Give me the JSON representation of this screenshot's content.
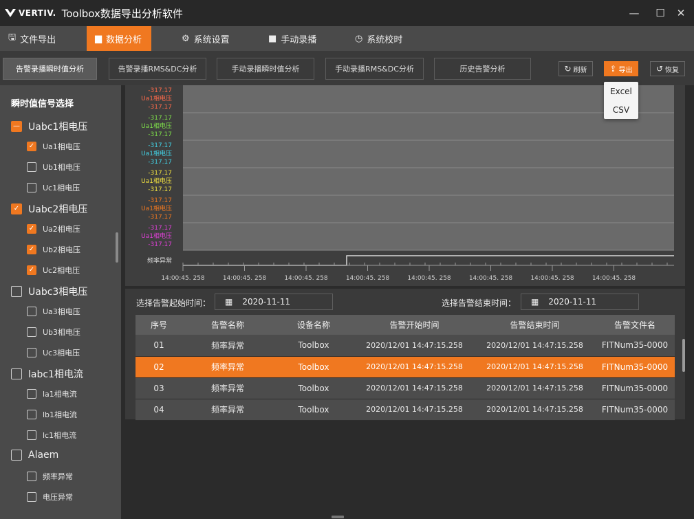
{
  "window": {
    "brand": "VERTIV.",
    "title": "Toolbox数据导出分析软件",
    "minimize": "—",
    "maximize": "☐",
    "close": "✕"
  },
  "menu": {
    "items": [
      {
        "label": "文件导出",
        "icon": "save-icon",
        "glyph": "🖫"
      },
      {
        "label": "数据分析",
        "icon": "bar-chart-icon",
        "glyph": "▆"
      },
      {
        "label": "系统设置",
        "icon": "gear-icon",
        "glyph": "⚙"
      },
      {
        "label": "手动录播",
        "icon": "video-camera-icon",
        "glyph": "■"
      },
      {
        "label": "系统校时",
        "icon": "clock-icon",
        "glyph": "◷"
      }
    ],
    "active": 1
  },
  "tabs": {
    "items": [
      "告警录播瞬时值分析",
      "告警录播RMS&DC分析",
      "手动录播瞬时值分析",
      "手动录播RMS&DC分析",
      "历史告警分析"
    ],
    "active": 0
  },
  "toolbar": {
    "refresh_label": "刷新",
    "export_label": "导出",
    "restore_label": "恢复",
    "refresh_icon": "↻",
    "export_icon": "⇪",
    "restore_icon": "↺"
  },
  "export_menu": {
    "options": [
      "Excel",
      "CSV"
    ]
  },
  "sidebar": {
    "title": "瞬时值信号选择",
    "groups": [
      {
        "label": "Uabc1相电压",
        "state": "partial",
        "items": [
          {
            "label": "Ua1相电压",
            "checked": true
          },
          {
            "label": "Ub1相电压",
            "checked": false
          },
          {
            "label": "Uc1相电压",
            "checked": false
          }
        ]
      },
      {
        "label": "Uabc2相电压",
        "state": "checked",
        "items": [
          {
            "label": "Ua2相电压",
            "checked": true
          },
          {
            "label": "Ub2相电压",
            "checked": true
          },
          {
            "label": "Uc2相电压",
            "checked": true
          }
        ]
      },
      {
        "label": "Uabc3相电压",
        "state": "unchecked",
        "items": [
          {
            "label": "Ua3相电压",
            "checked": false
          },
          {
            "label": "Ub3相电压",
            "checked": false
          },
          {
            "label": "Uc3相电压",
            "checked": false
          }
        ]
      },
      {
        "label": "labc1相电流",
        "state": "unchecked",
        "items": [
          {
            "label": "la1相电流",
            "checked": false
          },
          {
            "label": "lb1相电流",
            "checked": false
          },
          {
            "label": "lc1相电流",
            "checked": false
          }
        ]
      },
      {
        "label": "Alaem",
        "state": "unchecked",
        "items": [
          {
            "label": "频率异常",
            "checked": false
          },
          {
            "label": "电压异常",
            "checked": false
          }
        ]
      }
    ]
  },
  "chart": {
    "channels": [
      {
        "top": "-317.17",
        "name": "Ua1相电压",
        "bottom": "-317.17",
        "color": "#ff6a4a"
      },
      {
        "top": "-317.17",
        "name": "Ua1相电压",
        "bottom": "-317.17",
        "color": "#7fe04a"
      },
      {
        "top": "-317.17",
        "name": "Ua1相电压",
        "bottom": "-317.17",
        "color": "#43d3e6"
      },
      {
        "top": "-317.17",
        "name": "Ua1相电压",
        "bottom": "-317.17",
        "color": "#f0e040"
      },
      {
        "top": "-317.17",
        "name": "Ua1相电压",
        "bottom": "-317.17",
        "color": "#f07820"
      },
      {
        "top": "-317.17",
        "name": "Ua1相电压",
        "bottom": "-317.17",
        "color": "#e040d8"
      }
    ],
    "digital_label": "频率异常",
    "x_ticks": [
      "14:00:45. 258",
      "14:00:45. 258",
      "14:00:45. 258",
      "14:00:45. 258",
      "14:00:45. 258",
      "14:00:45. 258",
      "14:00:45. 258",
      "14:00:45. 258"
    ]
  },
  "filter": {
    "start_label": "选择告警起始时间：",
    "start_date": "2020-11-11",
    "end_label": "选择告警结束时间：",
    "end_date": "2020-11-11",
    "calendar_icon": "calendar-icon"
  },
  "table": {
    "columns": [
      "序号",
      "告警名称",
      "设备名称",
      "告警开始时间",
      "告警结束时间",
      "告警文件名"
    ],
    "rows": [
      [
        "01",
        "频率异常",
        "Toolbox",
        "2020/12/01  14:47:15.258",
        "2020/12/01  14:47:15.258",
        "FITNum35-0000"
      ],
      [
        "02",
        "频率异常",
        "Toolbox",
        "2020/12/01  14:47:15.258",
        "2020/12/01  14:47:15.258",
        "FITNum35-0000"
      ],
      [
        "03",
        "频率异常",
        "Toolbox",
        "2020/12/01  14:47:15.258",
        "2020/12/01  14:47:15.258",
        "FITNum35-0000"
      ],
      [
        "04",
        "频率异常",
        "Toolbox",
        "2020/12/01  14:47:15.258",
        "2020/12/01  14:47:15.258",
        "FITNum35-0000"
      ]
    ],
    "selected_row": 1
  },
  "colors": {
    "accent": "#f07820"
  }
}
